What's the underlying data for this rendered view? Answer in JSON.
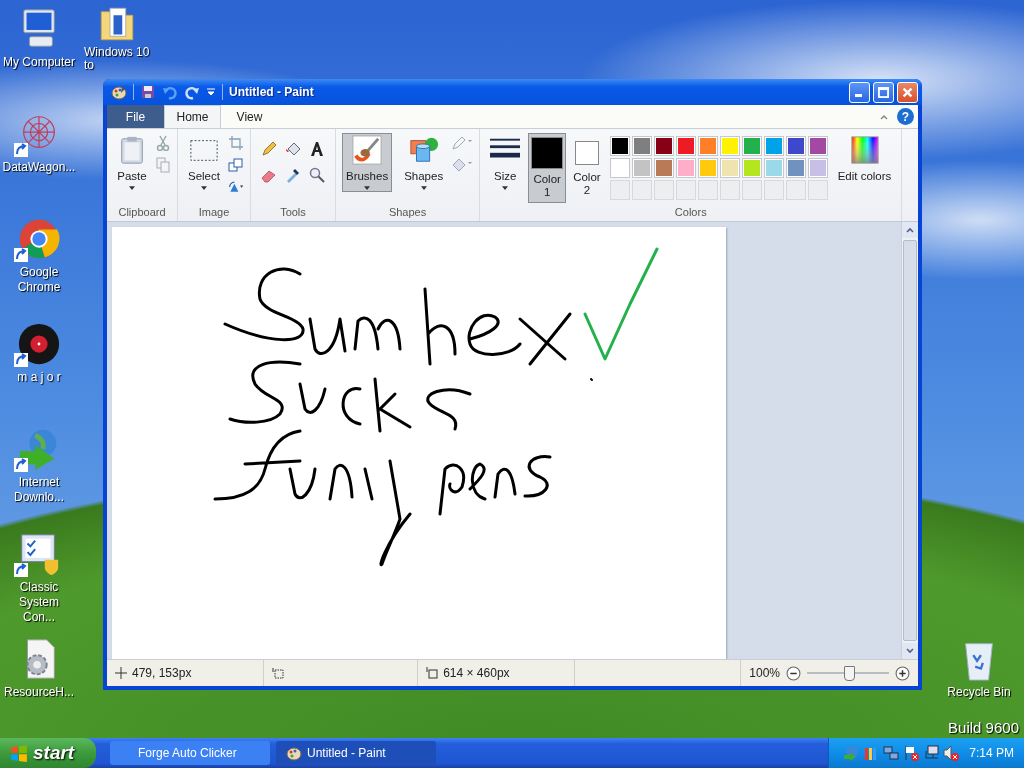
{
  "desktop": {
    "columns": [
      {
        "icons": [
          {
            "label": "My Computer",
            "kind": "computer",
            "shortcut": false
          },
          {
            "label": "DataWagon...",
            "kind": "mesh",
            "shortcut": true
          },
          {
            "label": "Google Chrome",
            "kind": "chrome",
            "shortcut": true
          },
          {
            "label": "m a j o r",
            "kind": "record",
            "shortcut": true
          },
          {
            "label": "Internet Downlo...",
            "kind": "globe",
            "shortcut": true
          },
          {
            "label": "Classic System Con...",
            "kind": "panel",
            "shortcut": true
          },
          {
            "label": "ResourceH...",
            "kind": "gearfile",
            "shortcut": false
          }
        ]
      },
      {
        "icons": [
          {
            "label": "Windows 10 to",
            "kind": "folder",
            "shortcut": false
          }
        ]
      },
      {
        "icons": [
          {
            "label": "Recycle Bin",
            "kind": "bin",
            "shortcut": false
          }
        ]
      }
    ],
    "build_text": "Build 9600"
  },
  "window": {
    "title": "Untitled - Paint",
    "help": "?",
    "tabs": [
      {
        "label": "File",
        "kind": "file",
        "selected": false
      },
      {
        "label": "Home",
        "kind": "tab",
        "selected": true
      },
      {
        "label": "View",
        "kind": "tab",
        "selected": false
      }
    ],
    "groups": [
      {
        "label": "Clipboard",
        "kind": "clipboard",
        "button": "Paste"
      },
      {
        "label": "Image",
        "kind": "image",
        "button": "Select"
      },
      {
        "label": "Tools",
        "kind": "tools"
      },
      {
        "label": "Shapes",
        "kind": "shapes",
        "brushes": {
          "label": "Brushes",
          "selected": true
        },
        "button": "Shapes"
      },
      {
        "label": "Colors",
        "kind": "colors",
        "size": "Size",
        "color_slots": [
          {
            "label": "Color",
            "number": "1",
            "color": "#000000",
            "selected": true
          },
          {
            "label": "Color",
            "number": "2",
            "color": "#ffffff",
            "selected": false
          }
        ],
        "palette": [
          [
            {
              "color": "#000000"
            },
            {
              "color": "#7f7f7f"
            },
            {
              "color": "#880015"
            },
            {
              "color": "#ed1c24"
            },
            {
              "color": "#ff7f27"
            },
            {
              "color": "#fff200"
            },
            {
              "color": "#22b14c"
            },
            {
              "color": "#00a2e8"
            },
            {
              "color": "#3f48cc"
            },
            {
              "color": "#a349a4"
            }
          ],
          [
            {
              "color": "#ffffff"
            },
            {
              "color": "#c3c3c3"
            },
            {
              "color": "#b97a57"
            },
            {
              "color": "#ffaec9"
            },
            {
              "color": "#ffc90e"
            },
            {
              "color": "#efe4b0"
            },
            {
              "color": "#b5e61d"
            },
            {
              "color": "#99d9ea"
            },
            {
              "color": "#7092be"
            },
            {
              "color": "#c8bfe7"
            }
          ]
        ],
        "edit": "Edit colors"
      }
    ],
    "status": {
      "position": "479, 153px",
      "canvas_size": "614 × 460px",
      "zoom": "100%",
      "zoom_slider": {
        "level": 0.5
      }
    }
  },
  "taskbar": {
    "start": "start",
    "tasks": [
      {
        "label": "Forge Auto Clicker",
        "selected": false,
        "kind": "blank"
      },
      {
        "label": "Untitled - Paint",
        "selected": true,
        "kind": "paint"
      }
    ],
    "clock": "7:14 PM"
  }
}
